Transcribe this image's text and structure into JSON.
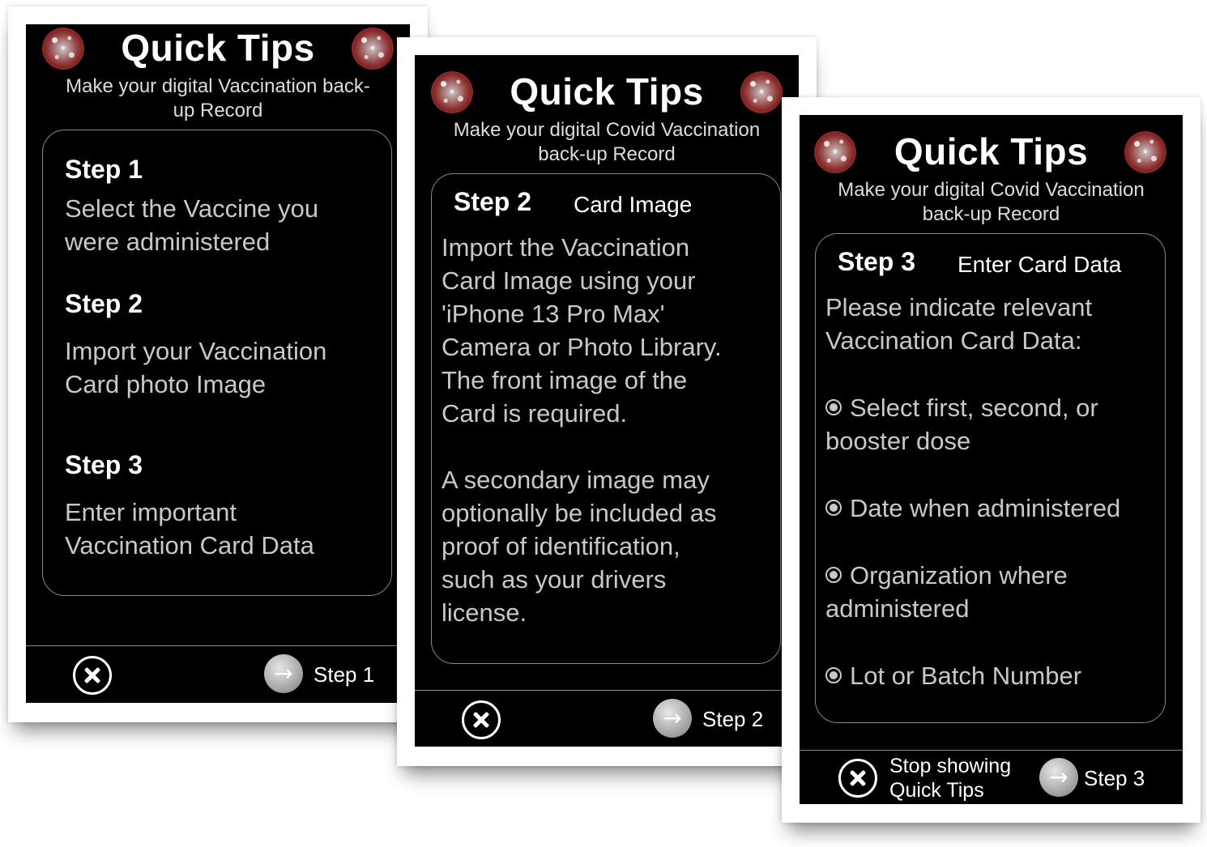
{
  "screens": [
    {
      "title": "Quick Tips",
      "subtitle_line1": "Make your digital Vaccination back-",
      "subtitle_line2": "up Record",
      "steps": [
        {
          "heading": "Step 1",
          "text_line1": "Select the Vaccine you",
          "text_line2": "were administered"
        },
        {
          "heading": "Step 2",
          "text_line1": "Import your Vaccination",
          "text_line2": "Card photo Image"
        },
        {
          "heading": "Step 3",
          "text_line1": "Enter important",
          "text_line2": "Vaccination Card Data"
        }
      ],
      "footer": {
        "next_label": "Step 1"
      }
    },
    {
      "title": "Quick Tips",
      "subtitle_line1": "Make your digital Covid Vaccination",
      "subtitle_line2": "back-up Record",
      "step_heading": "Step 2",
      "step_subtitle": "Card Image",
      "body_lines": [
        "Import the Vaccination",
        "Card Image using your",
        "'iPhone 13 Pro Max'",
        "Camera or Photo Library.",
        "The front image of the",
        "Card is required.",
        "",
        "A secondary image may",
        "optionally be included as",
        "proof of identification,",
        "such as your drivers",
        "license."
      ],
      "footer": {
        "next_label": "Step 2"
      }
    },
    {
      "title": "Quick Tips",
      "subtitle_line1": "Make your digital Covid Vaccination",
      "subtitle_line2": "back-up Record",
      "step_heading": "Step 3",
      "step_subtitle": "Enter Card Data",
      "intro_line1": "Please indicate relevant",
      "intro_line2": "Vaccination Card Data:",
      "bullets": [
        {
          "line1": "Select first, second, or",
          "line2": "booster dose"
        },
        {
          "line1": "Date when administered",
          "line2": ""
        },
        {
          "line1": "Organization where",
          "line2": "administered"
        },
        {
          "line1": "Lot or Batch Number",
          "line2": ""
        }
      ],
      "footer": {
        "stop_line1": "Stop showing",
        "stop_line2": "Quick Tips",
        "next_label": "Step 3"
      }
    }
  ]
}
